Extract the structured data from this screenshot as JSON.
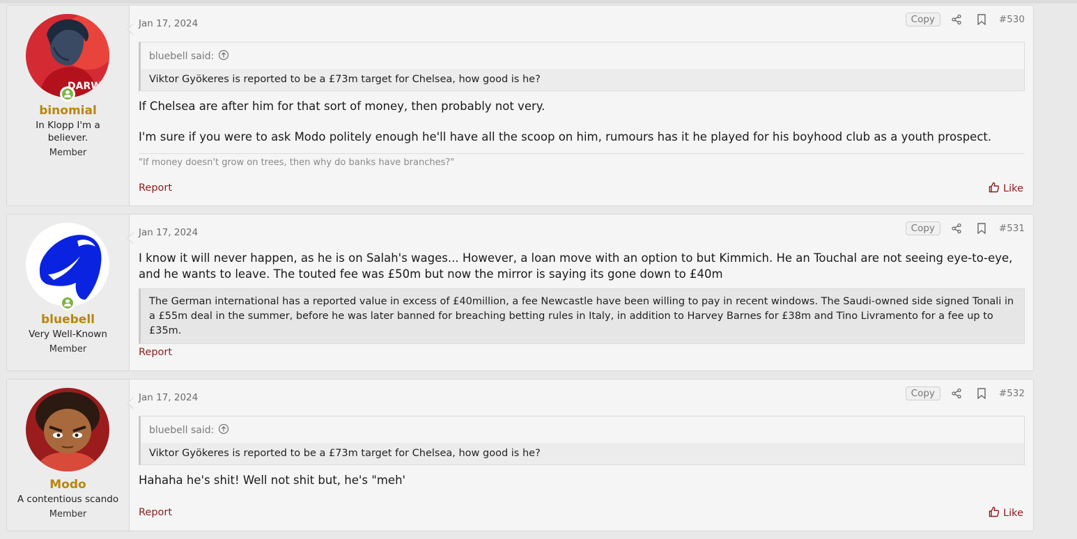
{
  "posts": [
    {
      "username": "binomial",
      "user_title": "In Klopp I'm a believer.",
      "user_role": "Member",
      "avatar": "red-footballer-portrait",
      "avatar_text": "DARWI",
      "date": "Jan 17, 2024",
      "copy_label": "Copy",
      "post_number": "#530",
      "quote_author": "bluebell said:",
      "quote_text": "Viktor Gyökeres is reported to be a £73m target for Chelsea, how good is he?",
      "message_line1": "If Chelsea are after him for that sort of money, then probably not very.",
      "message_line2": "I'm sure if you were to ask Modo politely enough he'll have all the scoop on him, rumours has it he played for his boyhood club as a youth prospect.",
      "signature": "\"If money doesn't grow on trees, then why do banks have branches?\"",
      "report_label": "Report",
      "like_label": "Like"
    },
    {
      "username": "bluebell",
      "user_title": "Very Well-Known",
      "user_role": "Member",
      "avatar": "blue-bell-logo",
      "date": "Jan 17, 2024",
      "copy_label": "Copy",
      "post_number": "#531",
      "message": "I know it will never happen, as he is on Salah's wages... However, a loan move with an option to but Kimmich. He an Touchal are not seeing eye-to-eye, and he wants to leave. The touted fee was £50m but now the mirror is saying its gone down to £40m",
      "blockquote": "The German international has a reported value in excess of £40million, a fee Newcastle have been willing to pay in recent windows. The Saudi-owned side signed Tonali in a £55m deal in the summer, before he was later banned for breaching betting rules in Italy, in addition to Harvey Barnes for £38m and Tino Livramento for a fee up to £35m.",
      "report_label": "Report"
    },
    {
      "username": "Modo",
      "user_title": "A contentious scando",
      "user_role": "Member",
      "avatar": "cartoon-boy-portrait",
      "date": "Jan 17, 2024",
      "copy_label": "Copy",
      "post_number": "#532",
      "quote_author": "bluebell said:",
      "quote_text": "Viktor Gyökeres is reported to be a £73m target for Chelsea, how good is he?",
      "message": "Hahaha he's shit! Well not shit but, he's \"meh'",
      "report_label": "Report",
      "like_label": "Like"
    }
  ],
  "icons": {
    "share": "share-icon",
    "bookmark": "bookmark-icon",
    "like": "thumbs-up-icon",
    "quote_jump": "arrow-up-circle-icon",
    "online": "online-status-icon"
  },
  "colors": {
    "username": "#b8860b",
    "link": "#8a1c1c",
    "online": "#7cb342"
  }
}
